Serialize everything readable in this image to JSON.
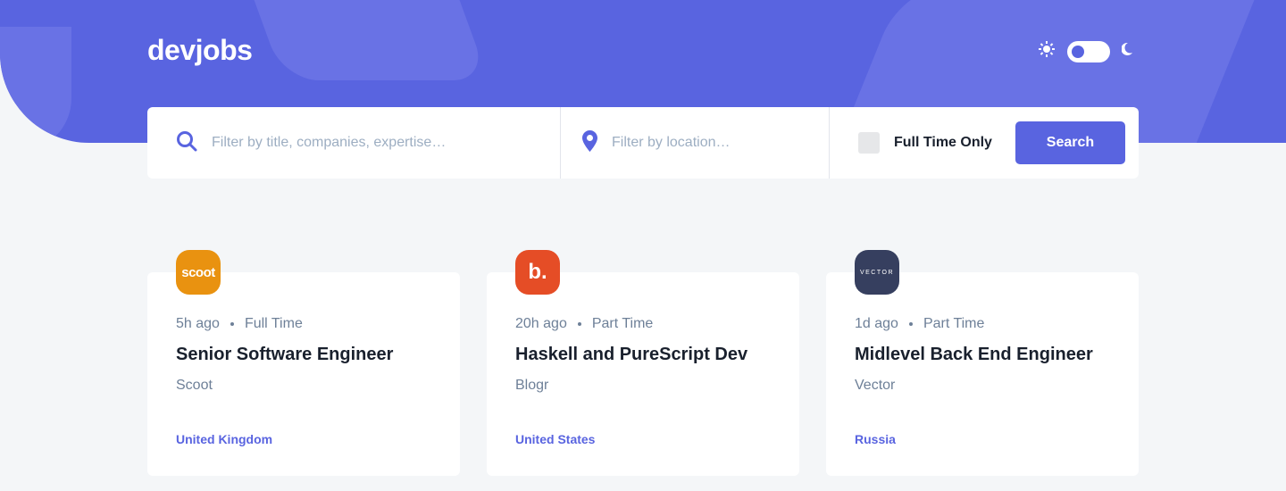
{
  "app": {
    "logo": "devjobs"
  },
  "theme": {
    "mode": "light"
  },
  "search": {
    "title_placeholder": "Filter by title, companies, expertise…",
    "location_placeholder": "Filter by location…",
    "fulltime_label": "Full Time Only",
    "button_label": "Search"
  },
  "colors": {
    "accent": "#5964E0",
    "background": "#F4F6F8",
    "text": "#19202D",
    "muted": "#6E8098"
  },
  "jobs": [
    {
      "logo_text": "scoot",
      "logo_color": "#E99210",
      "posted": "5h ago",
      "contract": "Full Time",
      "title": "Senior Software Engineer",
      "company": "Scoot",
      "location": "United Kingdom"
    },
    {
      "logo_text": "b.",
      "logo_color": "#E54D26",
      "posted": "20h ago",
      "contract": "Part Time",
      "title": "Haskell and PureScript Dev",
      "company": "Blogr",
      "location": "United States"
    },
    {
      "logo_text": "VECTOR",
      "logo_color": "#363F5F",
      "posted": "1d ago",
      "contract": "Part Time",
      "title": "Midlevel Back End Engineer",
      "company": "Vector",
      "location": "Russia"
    }
  ]
}
